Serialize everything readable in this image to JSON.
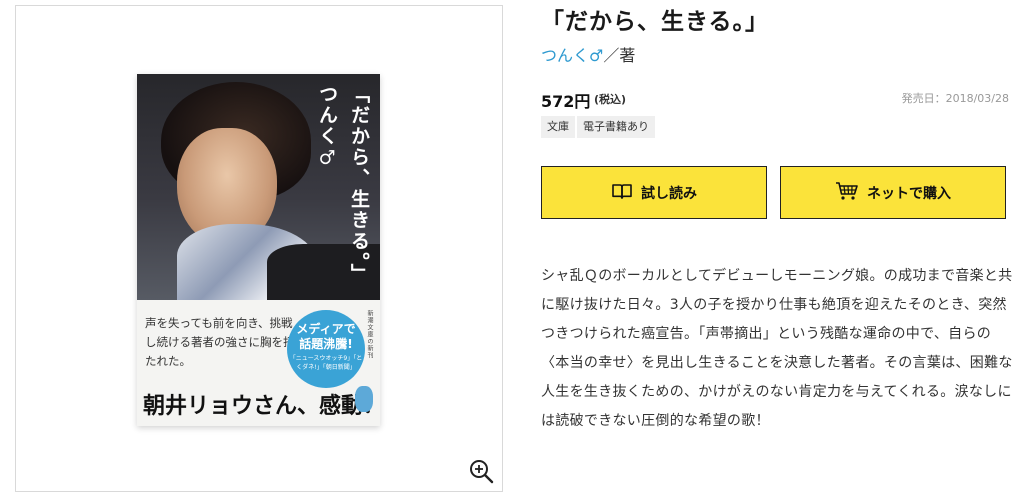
{
  "book": {
    "title": "「だから、生きる。」",
    "author": "つんく♂",
    "author_role": "／著",
    "price": "572円",
    "tax_note": "(税込)",
    "release": "発売日：2018/03/28",
    "tags": [
      "文庫",
      "電子書籍あり"
    ]
  },
  "buttons": {
    "read_label": "試し読み",
    "buy_label": "ネットで購入"
  },
  "description": "シャ乱Ｑのボーカルとしてデビューしモーニング娘。の成功まで音楽と共に駆け抜けた日々。3人の子を授かり仕事も絶頂を迎えたそのとき、突然つきつけられた癌宣告。「声帯摘出」という残酷な運命の中で、自らの〈本当の幸せ〉を見出し生きることを決意した著者。その言葉は、困難な人生を生き抜くための、かけがえのない肯定力を与えてくれる。涙なしには読破できない圧倒的な希望の歌！",
  "cover": {
    "title": "「だから、生きる。」つんく♂",
    "band_copy": "声を失っても前を向き、挑戦し続ける著者の強さに胸を打たれた。",
    "media_line1": "メディアで",
    "media_line2": "話題沸騰!",
    "media_line3": "「ニュースウオッチ9」「とくダネ!」「朝日新聞」",
    "band_big": "朝井リョウさん、感動!",
    "band_vertical": "新潮文庫の新刊"
  },
  "icons": {
    "zoom": "zoom-in-icon",
    "read": "book-open-icon",
    "buy": "cart-icon"
  },
  "colors": {
    "button_bg": "#fbe33a",
    "author_link": "#2f9ad0",
    "tag_bg": "#efefef"
  }
}
